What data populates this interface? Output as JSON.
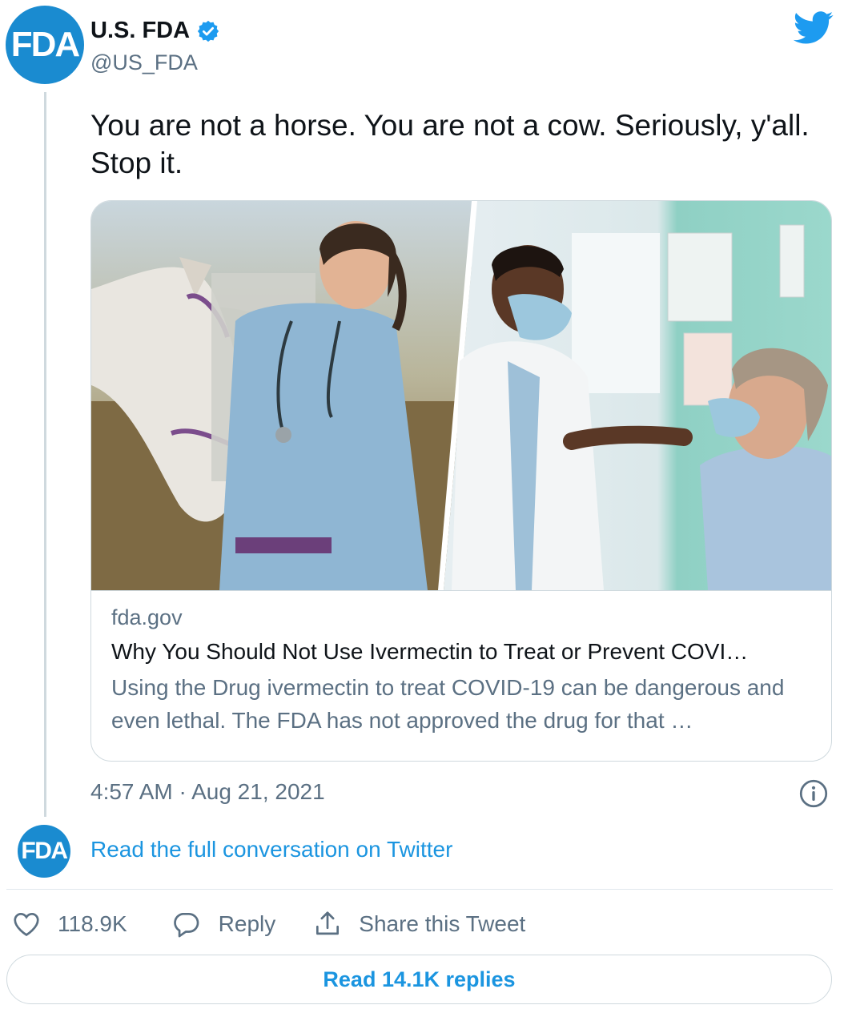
{
  "account": {
    "avatar_text": "FDA",
    "name": "U.S. FDA",
    "handle": "@US_FDA",
    "verified": true
  },
  "tweet": {
    "text": "You are not a horse. You are not a cow. Seriously, y'all. Stop it.",
    "timestamp": "4:57 AM · Aug 21, 2021"
  },
  "card": {
    "domain": "fda.gov",
    "title": "Why You Should Not Use Ivermectin to Treat or Prevent COVI…",
    "description": "Using the Drug ivermectin to treat COVID-19 can be dangerous and even lethal. The FDA has not approved the drug for that …"
  },
  "conversation": {
    "avatar_text": "FDA",
    "link_text": "Read the full conversation on Twitter"
  },
  "actions": {
    "like_count": "118.9K",
    "reply_label": "Reply",
    "share_label": "Share this Tweet"
  },
  "replies_button": "Read 14.1K replies",
  "icons": {
    "twitter": "twitter-bird-icon",
    "verified": "verified-badge-icon",
    "info": "info-icon",
    "like": "heart-icon",
    "reply": "speech-bubble-icon",
    "share": "share-upload-icon"
  },
  "colors": {
    "brand_blue": "#1d9bf0",
    "fda_blue": "#1a8bd0",
    "link_blue": "#1b95e0",
    "secondary_text": "#5b7083",
    "border": "#cfd9de"
  }
}
